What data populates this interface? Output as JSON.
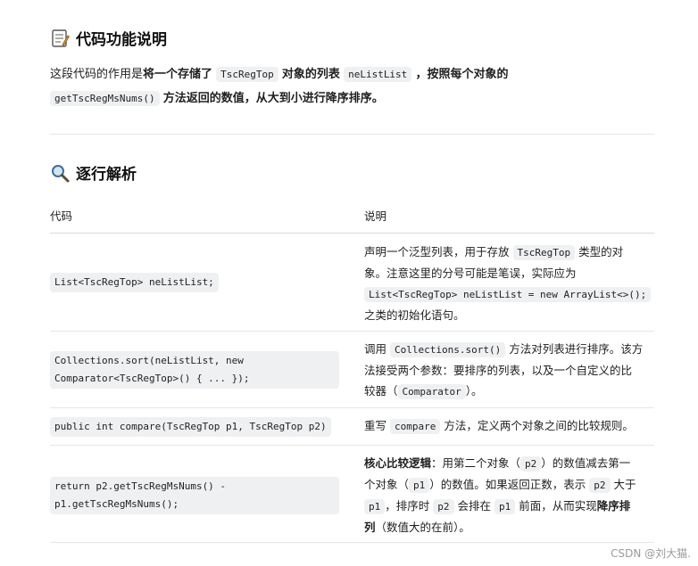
{
  "section1": {
    "title": "代码功能说明",
    "icon": "memo-icon",
    "p_pre": "这段代码的作用是",
    "p_b1": "将一个存储了",
    "p_code1": "TscRegTop",
    "p_b2": "对象的列表",
    "p_code2": "neListList",
    "p_b3": "，按照每个对象的",
    "p_code3": "getTscRegMsNums()",
    "p_b4": "方法返回的数值，从大到小进行降序排序。"
  },
  "section2": {
    "title": "逐行解析",
    "icon": "magnifier-icon",
    "headers": [
      "代码",
      "说明"
    ],
    "rows": [
      {
        "code": "List<TscRegTop> neListList;",
        "d1": "声明一个泛型列表，用于存放",
        "c1": "TscRegTop",
        "d2": "类型的对",
        "d3": "象。注意这里的分号可能是笔误，实际应为",
        "c2": "List<TscRegTop> neListList = new ArrayList<>();",
        "d4": "之类的初始化语句。"
      },
      {
        "code": "Collections.sort(neListList, new\nComparator<TscRegTop>() { ... });",
        "d1": "调用",
        "c1": "Collections.sort()",
        "d2": "方法对列表进行排序。该方",
        "d3": "法接受两个参数：要排序的列表，以及一个自定义的比",
        "d4": "较器（",
        "c2": "Comparator",
        "d5": "）。"
      },
      {
        "code": "public int compare(TscRegTop p1, TscRegTop p2)",
        "d1": "重写",
        "c1": "compare",
        "d2": "方法，定义两个对象之间的比较规则。"
      },
      {
        "code": "return p2.getTscRegMsNums() -\np1.getTscRegMsNums();",
        "b1": "核心比较逻辑",
        "d1": "：用第二个对象（",
        "c1": "p2",
        "d2": "）的数值减去第一",
        "d3": "个对象（",
        "c2": "p1",
        "d4": "）的数值。如果返回正数，表示",
        "c3": "p2",
        "d5": "大于",
        "c4": "p1",
        "d6": "，排序时",
        "c5": "p2",
        "d7": "会排在",
        "c6": "p1",
        "d8": "前面，从而实现",
        "b2": "降序排",
        "b3": "列",
        "d9": "（数值大的在前）。"
      }
    ]
  },
  "watermark": "CSDN @刘大猫."
}
